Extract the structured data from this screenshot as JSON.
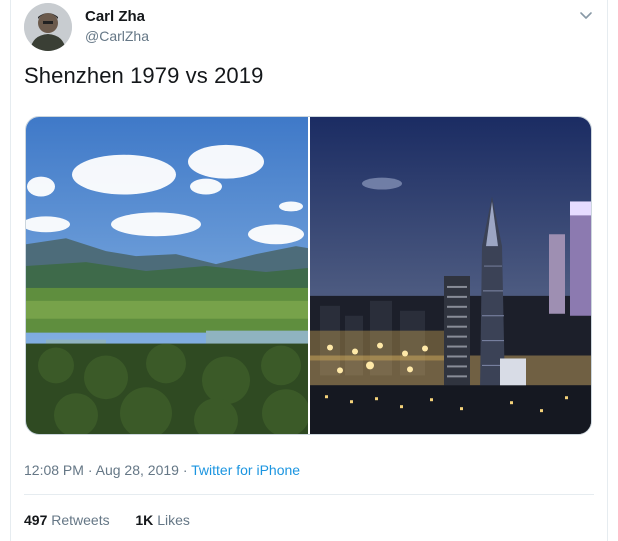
{
  "user": {
    "display_name": "Carl Zha",
    "handle": "@CarlZha",
    "avatar_icon": "user-avatar"
  },
  "tweet": {
    "text": "Shenzhen 1979 vs 2019",
    "time": "12:08 PM",
    "separator": "·",
    "date": "Aug 28, 2019",
    "source": "Twitter for iPhone"
  },
  "stats": {
    "retweets_count": "497",
    "retweets_label": "Retweets",
    "likes_count": "1K",
    "likes_label": "Likes"
  },
  "icons": {
    "menu": "chevron-down-icon"
  },
  "colors": {
    "link": "#1b95e0",
    "muted": "#657786",
    "text": "#14171a"
  }
}
